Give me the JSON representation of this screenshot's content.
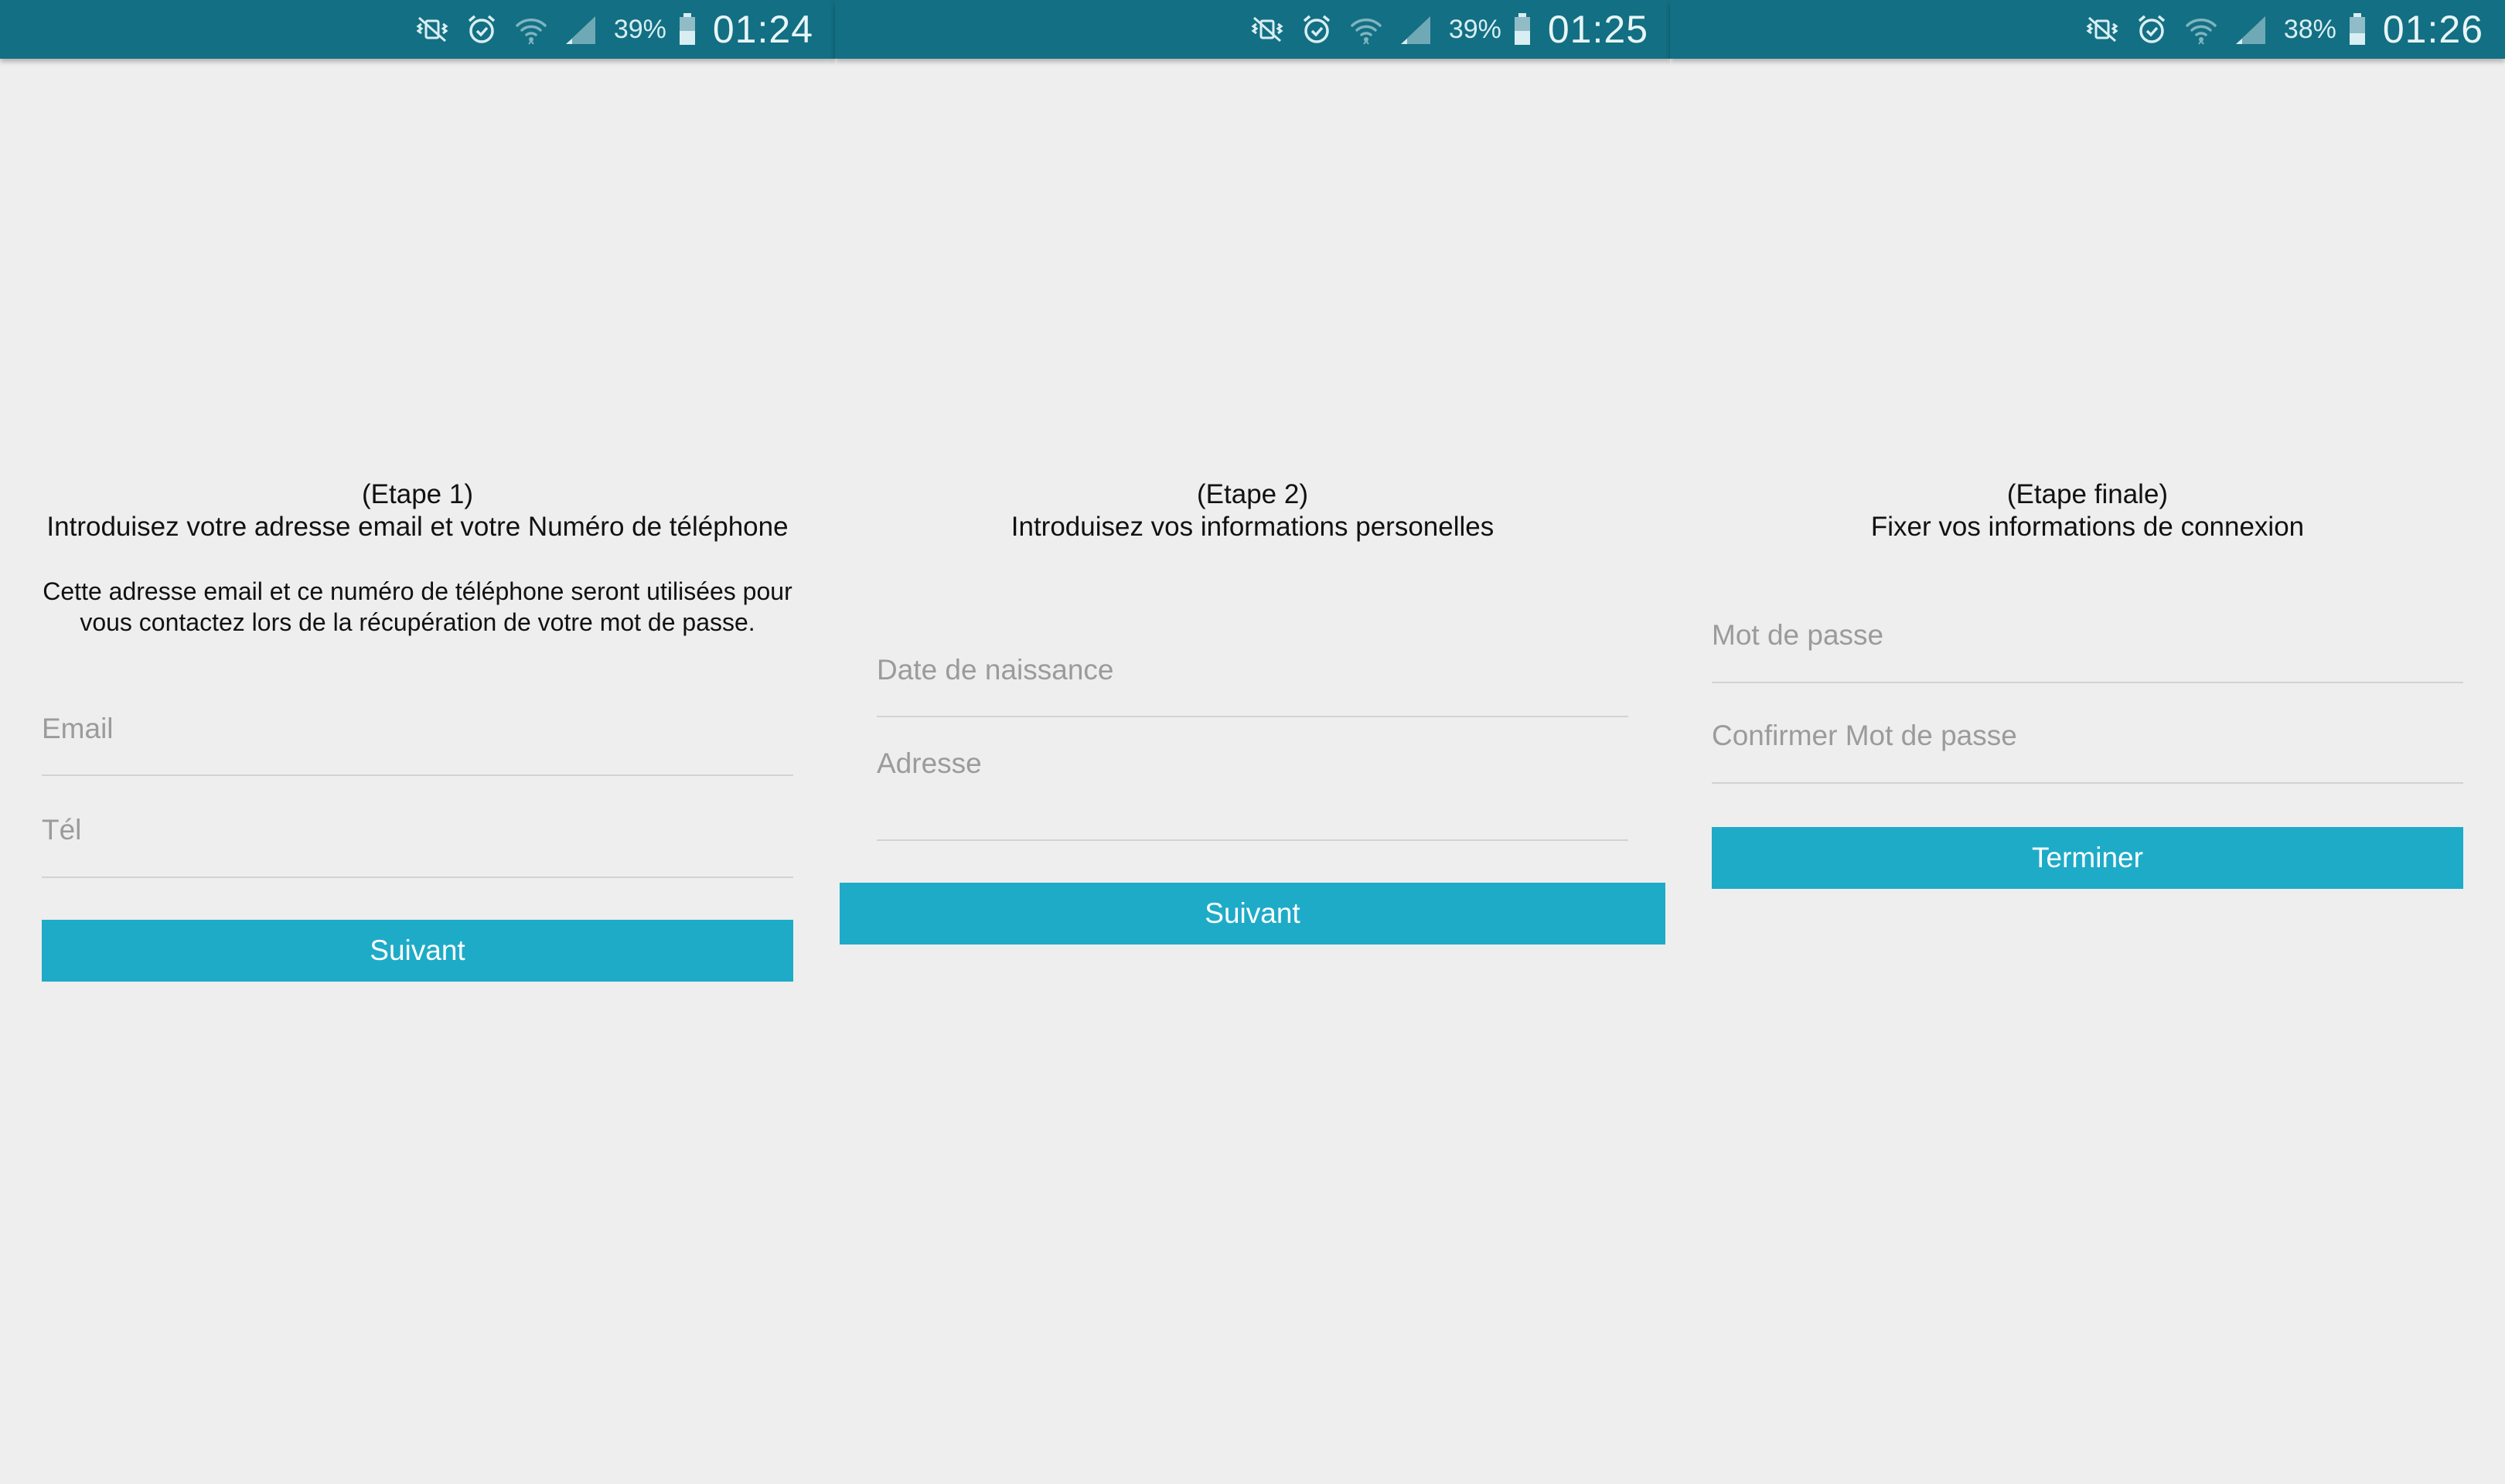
{
  "screens": [
    {
      "status": {
        "battery": "39%",
        "time": "01:24"
      },
      "step_label": "(Etape 1)",
      "step_title": "Introduisez votre adresse email et votre Numéro de téléphone",
      "note_line1": "Cette adresse email et ce numéro de téléphone seront utilisées pour",
      "note_line2": "vous contactez lors de la récupération de votre mot de passe.",
      "fields": [
        {
          "placeholder": "Email",
          "value": ""
        },
        {
          "placeholder": "Tél",
          "value": ""
        }
      ],
      "button_label": "Suivant"
    },
    {
      "status": {
        "battery": "39%",
        "time": "01:25"
      },
      "step_label": "(Etape 2)",
      "step_title": "Introduisez vos informations personelles",
      "fields": [
        {
          "placeholder": "Date de naissance",
          "value": ""
        },
        {
          "placeholder": "Adresse",
          "value": ""
        }
      ],
      "button_label": "Suivant"
    },
    {
      "status": {
        "battery": "38%",
        "time": "01:26"
      },
      "step_label": "(Etape finale)",
      "step_title": "Fixer vos informations de connexion",
      "fields": [
        {
          "placeholder": "Mot de passe",
          "value": ""
        },
        {
          "placeholder": "Confirmer Mot de passe",
          "value": ""
        }
      ],
      "button_label": "Terminer"
    }
  ],
  "icons": [
    "vibrate-mute-icon",
    "alarm-icon",
    "wifi-icon",
    "signal-icon",
    "battery-icon"
  ],
  "colors": {
    "status_bar": "#136f83",
    "background": "#eeeeee",
    "accent_button": "#1eabc8",
    "field_underline": "#d2d2d2",
    "placeholder_text": "#9b9b9b"
  }
}
